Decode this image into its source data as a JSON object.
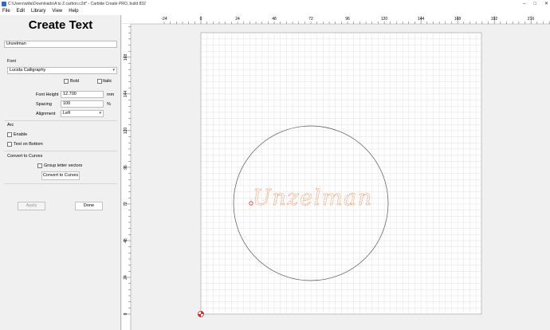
{
  "window": {
    "title": "C:\\Users\\willa\\Downloads\\A to Z.carbon.c2d* - Carbide Create PRO, build 832",
    "controls": [
      "–",
      "□",
      "✕"
    ]
  },
  "menu": [
    {
      "label": "File",
      "key": "F"
    },
    {
      "label": "Edit",
      "key": "E"
    },
    {
      "label": "Library",
      "key": ""
    },
    {
      "label": "View",
      "key": ""
    },
    {
      "label": "Help",
      "key": ""
    }
  ],
  "panel": {
    "title": "Create Text",
    "text_value": "Unzelman",
    "font_label": "Font",
    "font_value": "Lucida Calligraphy",
    "bold_label": "Bold",
    "italic_label": "Italic",
    "font_height_label": "Font Height",
    "font_height_value": "12.700",
    "font_height_unit": "mm",
    "spacing_label": "Spacing",
    "spacing_value": "100",
    "spacing_unit": "%",
    "alignment_label": "Alignment",
    "alignment_value": "Left",
    "arc_label": "Arc",
    "enable_label": "Enable",
    "text_on_bottom_label": "Text on Bottom",
    "convert_section_label": "Convert to Curves",
    "group_letter_vectors_label": "Group letter vectors",
    "convert_button": "Convert to Curves",
    "apply_button": "Apply",
    "done_button": "Done"
  },
  "canvas": {
    "ruler_x_labels": [
      "-24",
      "0",
      "24",
      "48",
      "72",
      "96",
      "120",
      "144",
      "168",
      "192",
      "216"
    ],
    "ruler_y_labels": [
      "168",
      "144",
      "120",
      "96",
      "72",
      "48",
      "24",
      "0"
    ],
    "text_on_canvas": "Unzelman",
    "text_color": "#f08a4b",
    "circle_color": "#555555",
    "origin_marker_color": "#d62a2a"
  }
}
